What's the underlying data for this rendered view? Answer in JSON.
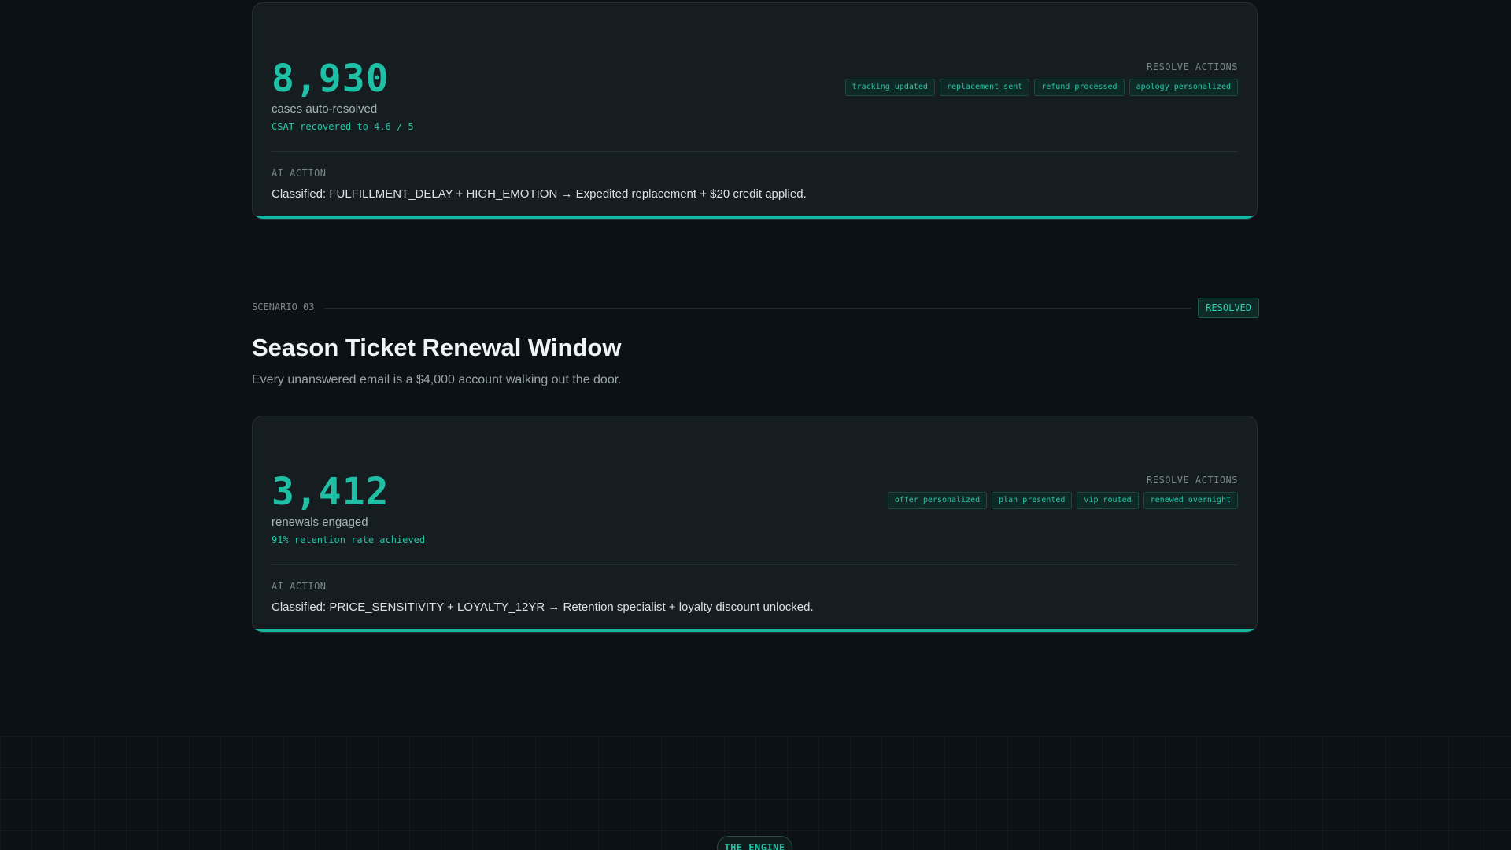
{
  "card1": {
    "metric": "8,930",
    "metric_label": "cases auto-resolved",
    "metric_sub": "CSAT recovered to 4.6 / 5",
    "actions_title": "RESOLVE ACTIONS",
    "tags": [
      "tracking_updated",
      "replacement_sent",
      "refund_processed",
      "apology_personalized"
    ],
    "ai_title": "AI ACTION",
    "ai_text": "Classified: FULFILLMENT_DELAY + HIGH_EMOTION → Expedited replacement + $20 credit applied."
  },
  "scenario3": {
    "label": "SCENARIO_03",
    "status": "RESOLVED",
    "title": "Season Ticket Renewal Window",
    "description": "Every unanswered email is a $4,000 account walking out the door."
  },
  "card2": {
    "metric": "3,412",
    "metric_label": "renewals engaged",
    "metric_sub": "91% retention rate achieved",
    "actions_title": "RESOLVE ACTIONS",
    "tags": [
      "offer_personalized",
      "plan_presented",
      "vip_routed",
      "renewed_overnight"
    ],
    "ai_title": "AI ACTION",
    "ai_text": "Classified: PRICE_SENSITIVITY + LOYALTY_12YR → Retention specialist + loyalty discount unlocked."
  },
  "engine": {
    "label": "THE ENGINE"
  },
  "colors": {
    "accent": "#14b8a0",
    "background": "#0b1114",
    "card": "#161d20"
  }
}
